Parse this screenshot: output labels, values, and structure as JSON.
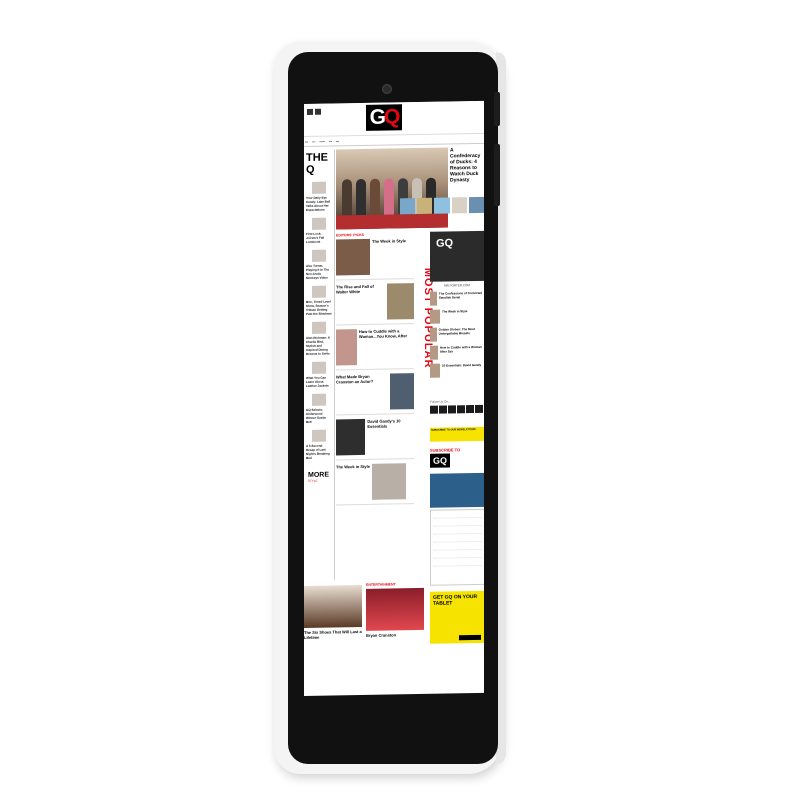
{
  "site": {
    "logo_g": "G",
    "logo_q": "Q"
  },
  "colors": {
    "accent": "#e30613",
    "newsletter": "#f6e400"
  },
  "headline": {
    "title": "A Confederacy of Ducks: 4 Reasons to Watch Duck Dynasty"
  },
  "sidebar": {
    "brand": "THE Q",
    "items": [
      {
        "title": "Your Daily Eye Candy: Lake Bell Talks About Her Expectations"
      },
      {
        "title": "First Look: J.Crew's Fall Lookbook"
      },
      {
        "title": "Alec Turner, Playing It In The Neo-Arctic Monkeys Video"
      },
      {
        "title": "Brie, Timed Level Show, Season's Tribute Getting Past the Shadows"
      },
      {
        "title": "Alan Richman: A Charlie Bird, Stylish and Inspired Dining Returns to SoHo"
      },
      {
        "title": "What You Can Learn About Leather Jackets"
      },
      {
        "title": "GQ Selects: Underwood Winner Suede Belt"
      },
      {
        "title": "A 6-Second Recap of Last Night's Breaking Bad"
      }
    ],
    "more": "MORE",
    "more_sub": "STYLE"
  },
  "editors": {
    "label": "EDITORS' PICKS",
    "cards": [
      {
        "title": "The Week in Style"
      },
      {
        "title": "The Rise and Fall of Walter White"
      },
      {
        "title": "How to Cuddle with a Woman...You Know, After"
      },
      {
        "title": "What Made Bryan Cranston an Actor?"
      },
      {
        "title": "David Gandy's 10 Essentials"
      },
      {
        "title": "The Week in Style"
      }
    ]
  },
  "popular": {
    "word1": "MOST",
    "word2": "POPULAR",
    "items": [
      {
        "title": "The Confessions of Convicted Swedish Serial"
      },
      {
        "title": "The Week in Style"
      },
      {
        "title": "Golden Globes: The Most Unforgettable Breasts"
      },
      {
        "title": "How to Cuddle with a Woman After Sex"
      },
      {
        "title": "10 Essentials: David Gandy"
      }
    ]
  },
  "ads": {
    "gq_selects": "GQ",
    "mr_porter": "MR PORTER.COM",
    "follow": "Follow Us On...",
    "newsletter": "SUBSCRIBE TO OUR NEWSLETTERS",
    "subscribe": "SUBSCRIBE TO",
    "subscribe_gq": "GQ",
    "tablet": "GET GQ ON YOUR TABLET",
    "learn_more": "LEARN MORE"
  },
  "bottom": {
    "left_title": "The Six Shoes That Will Last a Lifetime",
    "right_label": "ENTERTAINMENT",
    "right_title": "Bryan Cranston"
  }
}
